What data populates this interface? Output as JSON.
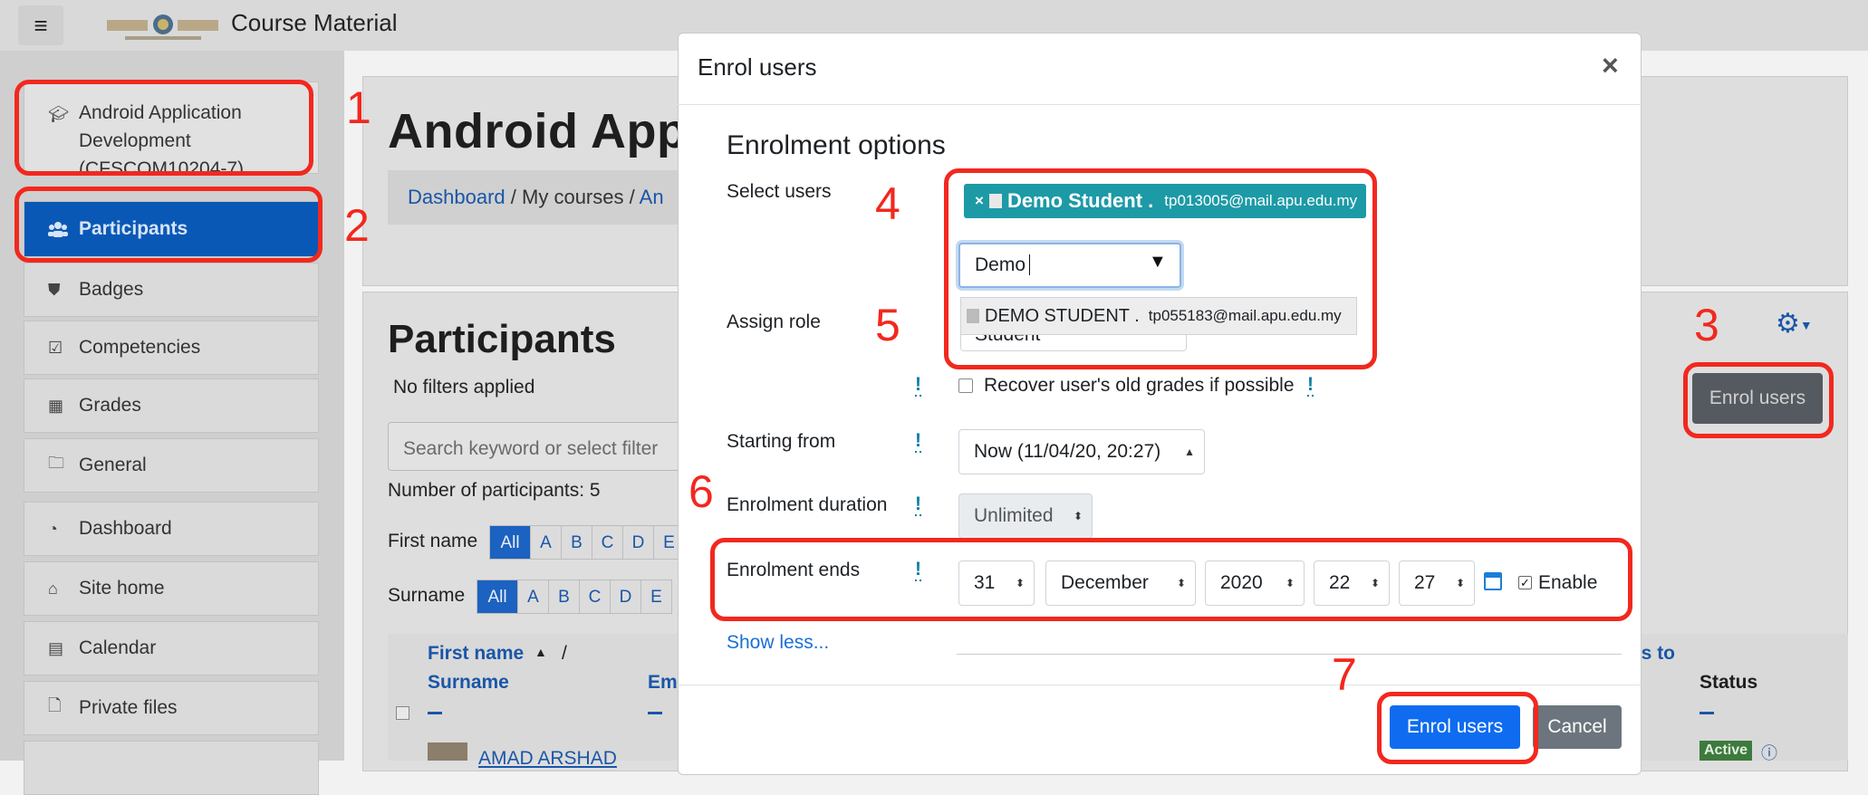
{
  "navbar": {
    "menu_icon": "hamburger-icon",
    "site_name": "Course Material"
  },
  "drawer": {
    "items": [
      {
        "label": "Android Application Development (CFSCOM10204-7)",
        "icon": "graduation-cap-icon"
      },
      {
        "label": "Participants",
        "icon": "users-icon"
      },
      {
        "label": "Badges",
        "icon": "shield-icon"
      },
      {
        "label": "Competencies",
        "icon": "check-square-icon"
      },
      {
        "label": "Grades",
        "icon": "table-icon"
      },
      {
        "label": "General",
        "icon": "folder-icon"
      },
      {
        "label": "Dashboard",
        "icon": "tachometer-icon"
      },
      {
        "label": "Site home",
        "icon": "home-icon"
      },
      {
        "label": "Calendar",
        "icon": "calendar-icon"
      },
      {
        "label": "Private files",
        "icon": "file-icon"
      }
    ]
  },
  "page": {
    "heading": "Android Appli",
    "breadcrumb": [
      "Dashboard",
      "/",
      "My courses",
      "/",
      "An"
    ],
    "participants_title": "Participants",
    "filters_text": "No filters applied",
    "search_placeholder": "Search keyword or select filter",
    "num_participants": "Number of participants: 5",
    "firstname_label": "First name",
    "surname_label": "Surname",
    "letters_all": "All",
    "letters": [
      "A",
      "B",
      "C",
      "D",
      "E"
    ],
    "table": {
      "col_firstname": "First name",
      "col_surname": "Surname",
      "col_slash": "/",
      "col_email": "Em",
      "col_access": "ss to",
      "col_status": "Status",
      "row1_name": "AMAD ARSHAD",
      "row1_status": "Active"
    },
    "enrol_users_button": "Enrol users"
  },
  "modal": {
    "title": "Enrol users",
    "close": "×",
    "section_heading": "Enrolment options",
    "select_users_label": "Select users",
    "selected_user": {
      "remove": "×",
      "name": "Demo Student .",
      "email": "tp013005@mail.apu.edu.my"
    },
    "search_value": "Demo",
    "dropdown_arrow": "▼",
    "suggestion": {
      "name": "DEMO STUDENT .",
      "email": "tp055183@mail.apu.edu.my"
    },
    "assign_role_label": "Assign role",
    "assign_role_value": "Student",
    "help_mark": "!",
    "recover_grades_label": "Recover user's old grades if possible",
    "starting_from_label": "Starting from",
    "starting_from_value": "Now (11/04/20, 20:27)",
    "duration_label": "Enrolment duration",
    "duration_value": "Unlimited",
    "ends_label": "Enrolment ends",
    "ends_day": "31",
    "ends_month": "December",
    "ends_year": "2020",
    "ends_hour": "22",
    "ends_minute": "27",
    "enable_label": "Enable",
    "enable_checked": true,
    "show_less": "Show less...",
    "enrol_button": "Enrol users",
    "cancel_button": "Cancel"
  },
  "annotations": {
    "numbers": [
      "1",
      "2",
      "3",
      "4",
      "5",
      "6",
      "7"
    ],
    "color": "#f2281e"
  }
}
